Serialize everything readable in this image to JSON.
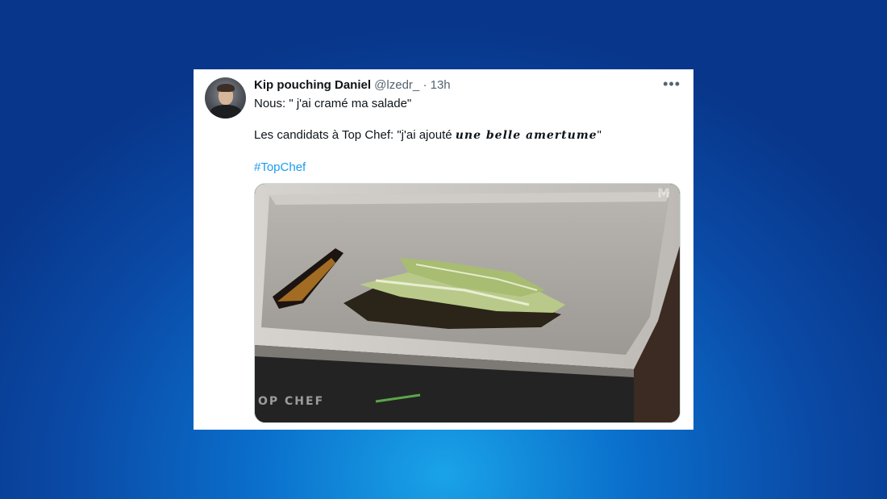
{
  "tweet": {
    "author_name": "Kip pouching Daniel",
    "handle": "@lzedr_",
    "separator": "·",
    "time": "13h",
    "more_icon": "more-horizontal-icon",
    "line1": "Nous: \" j'ai cramé ma salade\"",
    "line2_prefix": "Les candidats à Top Chef:  \"j'ai ajouté ",
    "line2_fancy": "une belle amertume",
    "line2_suffix": "\"",
    "hashtag": "#TopChef",
    "media": {
      "watermark": "OP CHEF",
      "corner_mark": "M"
    }
  },
  "colors": {
    "link": "#1d9bf0",
    "secondary_text": "#536471",
    "primary_text": "#0f1419"
  }
}
